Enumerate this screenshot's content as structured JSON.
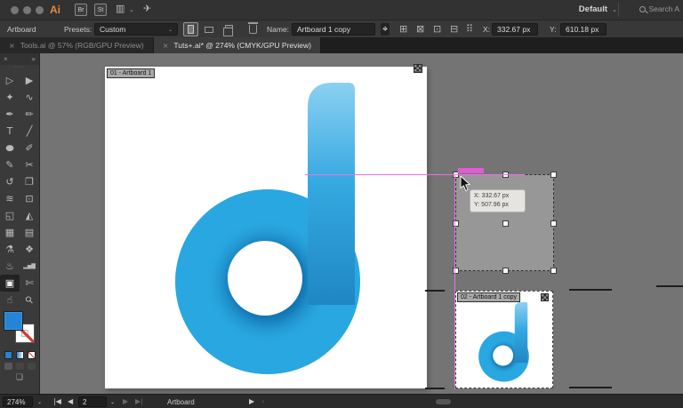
{
  "titlebar": {
    "app_icon": "Ai",
    "bridge_badge": "Br",
    "stock_badge": "St",
    "icons": {
      "workspace": "▥",
      "workspace_caret": "⌄",
      "send": "✈",
      "default_caret": "⌄"
    },
    "workspace_menu_label": "Default",
    "search_text": "Search A"
  },
  "controlbar": {
    "context_label": "Artboard",
    "presets_label": "Presets:",
    "presets_value": "Custom",
    "presets_caret": "⌄",
    "name_label": "Name:",
    "name_value": "Artboard 1 copy",
    "icons": {
      "move_artwork": "⌖",
      "preset_center": "⊞",
      "preset_cross": "⊠",
      "preset_dot": "⊡",
      "options_panel": "⊟",
      "grid_marks": "⠿"
    },
    "x_label": "X:",
    "x_value": "332.67 px",
    "y_label": "Y:",
    "y_value": "610.18 px"
  },
  "tabs": [
    {
      "label": "Tools.ai @ 57% (RGB/GPU Preview)",
      "active": false
    },
    {
      "label": "Tuts+.ai* @ 274% (CMYK/GPU Preview)",
      "active": true
    }
  ],
  "toolpanel": {
    "close_glyph": "×",
    "collapse_glyph": "»",
    "grip_glyph": "····",
    "tools": [
      {
        "name": "selection-tool",
        "glyph": "▷"
      },
      {
        "name": "direct-selection-tool",
        "glyph": "▶"
      },
      {
        "name": "magic-wand-tool",
        "glyph": "✦"
      },
      {
        "name": "lasso-tool",
        "glyph": "∿"
      },
      {
        "name": "pen-tool",
        "glyph": "✒"
      },
      {
        "name": "curvature-tool",
        "glyph": "✏"
      },
      {
        "name": "type-tool",
        "glyph": "T"
      },
      {
        "name": "line-segment-tool",
        "glyph": "╱"
      },
      {
        "name": "ellipse-tool",
        "glyph": "●"
      },
      {
        "name": "paintbrush-tool",
        "glyph": "✐"
      },
      {
        "name": "pencil-tool",
        "glyph": "✎"
      },
      {
        "name": "scissors-tool",
        "glyph": "✂"
      },
      {
        "name": "rotate-tool",
        "glyph": "↺"
      },
      {
        "name": "scale-tool",
        "glyph": "❐"
      },
      {
        "name": "width-tool",
        "glyph": "≋"
      },
      {
        "name": "free-transform-tool",
        "glyph": "⊡"
      },
      {
        "name": "shape-builder-tool",
        "glyph": "◱"
      },
      {
        "name": "perspective-grid-tool",
        "glyph": "◭"
      },
      {
        "name": "mesh-tool",
        "glyph": "▦"
      },
      {
        "name": "gradient-tool",
        "glyph": "▤"
      },
      {
        "name": "eyedropper-tool",
        "glyph": "⚗"
      },
      {
        "name": "blend-tool",
        "glyph": "❖"
      },
      {
        "name": "symbol-sprayer-tool",
        "glyph": "♨"
      },
      {
        "name": "column-graph-tool",
        "glyph": "▂▅▇"
      },
      {
        "name": "artboard-tool",
        "glyph": "▣",
        "active": true
      },
      {
        "name": "slice-tool",
        "glyph": "✄"
      },
      {
        "name": "hand-tool",
        "glyph": "☝"
      },
      {
        "name": "zoom-tool",
        "glyph": "⚲"
      }
    ],
    "screen_mode_glyph": "❏"
  },
  "canvas": {
    "artboard1_label": "01 - Artboard 1",
    "artboard2_label": "02 - Artboard 1 copy",
    "drag_tooltip_x": "X: 332.67 px",
    "drag_tooltip_y": "Y: 507.96 px"
  },
  "statusbar": {
    "zoom_value": "274%",
    "zoom_caret": "⌄",
    "nav_first": "|◀",
    "nav_prev": "◀",
    "artboard_number": "2",
    "nav_caret": "⌄",
    "nav_next": "▶",
    "nav_last": "▶|",
    "status_label": "Artboard",
    "flyout": "▶",
    "scroll_hint": "‹"
  },
  "colors": {
    "logo_blue": "#29A7E0",
    "logo_blue_dark": "#0E6AA8",
    "logo_blue_light": "#8BD0F2",
    "smart_guide_magenta": "#EF6FE0",
    "fill_swatch_blue": "#2484D6"
  }
}
